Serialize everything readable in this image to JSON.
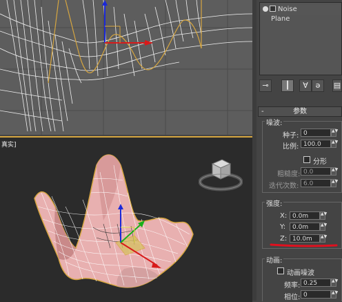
{
  "viewports": {
    "perspective_label": "真实]"
  },
  "modifier_stack": {
    "items": [
      {
        "label": "Noise",
        "kind": "modifier"
      },
      {
        "label": "Plane",
        "kind": "object"
      }
    ]
  },
  "parameters": {
    "rollout_title": "参数",
    "noise": {
      "group_label": "噪波:",
      "seed_label": "种子:",
      "seed_value": "0",
      "scale_label": "比例:",
      "scale_value": "100.0",
      "fractal_label": "分形",
      "roughness_label": "粗糙度:",
      "roughness_value": "0.0",
      "iterations_label": "迭代次数:",
      "iterations_value": "6.0"
    },
    "strength": {
      "group_label": "强度:",
      "x_label": "X:",
      "x_value": "0.0m",
      "y_label": "Y:",
      "y_value": "0.0m",
      "z_label": "Z:",
      "z_value": "10.0m"
    },
    "animation": {
      "group_label": "动画:",
      "animate_noise_label": "动画噪波",
      "frequency_label": "频率:",
      "frequency_value": "0.25",
      "phase_label": "相位:",
      "phase_value": "0"
    }
  },
  "colors": {
    "annotation_underline": "#e0101e",
    "surface": "#e8b0b0",
    "selection_orange": "#d6a640"
  }
}
